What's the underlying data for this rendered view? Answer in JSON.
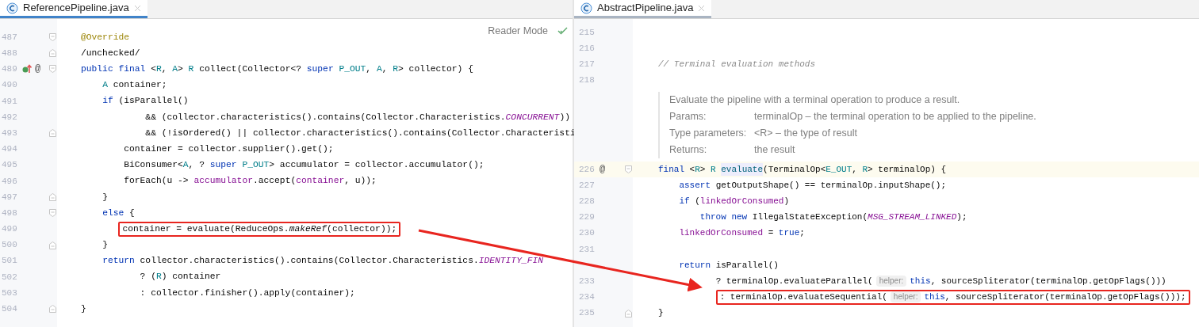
{
  "panes": [
    {
      "tab": {
        "title": "ReferencePipeline.java",
        "selected": true
      },
      "reader_mode": "Reader Mode",
      "lines": [
        {
          "kind": "code",
          "number": "487",
          "fold": {
            "kind": "start"
          },
          "current": false,
          "boxed": false,
          "tokens": [
            {
              "text": "@Override",
              "kind": "annotation"
            }
          ]
        },
        {
          "kind": "code",
          "number": "488",
          "fold": {
            "kind": "end"
          },
          "current": false,
          "boxed": false,
          "tokens": [
            {
              "text": "/unchecked/",
              "kind": "plain"
            }
          ]
        },
        {
          "kind": "code",
          "number": "489",
          "fold": {
            "kind": "start"
          },
          "current": false,
          "boxed": false,
          "override_mark": true,
          "at_mark": "@",
          "tokens": [
            {
              "text": "public final ",
              "kind": "keyword"
            },
            {
              "text": "<",
              "kind": "plain"
            },
            {
              "text": "R",
              "kind": "type_param"
            },
            {
              "text": ", ",
              "kind": "plain"
            },
            {
              "text": "A",
              "kind": "type_param"
            },
            {
              "text": "> ",
              "kind": "plain"
            },
            {
              "text": "R",
              "kind": "type_param"
            },
            {
              "text": " collect(Collector<? ",
              "kind": "plain"
            },
            {
              "text": "super ",
              "kind": "keyword"
            },
            {
              "text": "P_OUT",
              "kind": "type_param"
            },
            {
              "text": ", ",
              "kind": "plain"
            },
            {
              "text": "A",
              "kind": "type_param"
            },
            {
              "text": ", ",
              "kind": "plain"
            },
            {
              "text": "R",
              "kind": "type_param"
            },
            {
              "text": "> collector) {",
              "kind": "plain"
            }
          ]
        },
        {
          "kind": "code",
          "number": "490",
          "current": false,
          "boxed": false,
          "tokens": [
            {
              "text": "    A",
              "kind": "type_param"
            },
            {
              "text": " container;",
              "kind": "plain"
            }
          ]
        },
        {
          "kind": "code",
          "number": "491",
          "current": false,
          "boxed": false,
          "tokens": [
            {
              "text": "    if ",
              "kind": "keyword"
            },
            {
              "text": "(isParallel()",
              "kind": "plain"
            }
          ]
        },
        {
          "kind": "code",
          "number": "492",
          "current": false,
          "boxed": false,
          "tokens": [
            {
              "text": "            && (collector.characteristics().contains(Collector.Characteristics.",
              "kind": "plain"
            },
            {
              "text": "CONCURRENT",
              "kind": "constant"
            },
            {
              "text": "))",
              "kind": "plain"
            }
          ]
        },
        {
          "kind": "code",
          "number": "493",
          "fold": {
            "kind": "end"
          },
          "current": false,
          "boxed": false,
          "tokens": [
            {
              "text": "            && (!isOrdered() || collector.characteristics().contains(Collector.Characteristi",
              "kind": "plain"
            }
          ]
        },
        {
          "kind": "code",
          "number": "494",
          "current": false,
          "boxed": false,
          "tokens": [
            {
              "text": "        container = collector.supplier().get();",
              "kind": "plain"
            }
          ]
        },
        {
          "kind": "code",
          "number": "495",
          "current": false,
          "boxed": false,
          "tokens": [
            {
              "text": "        BiConsumer<",
              "kind": "plain"
            },
            {
              "text": "A",
              "kind": "type_param"
            },
            {
              "text": ", ? ",
              "kind": "plain"
            },
            {
              "text": "super ",
              "kind": "keyword"
            },
            {
              "text": "P_OUT",
              "kind": "type_param"
            },
            {
              "text": "> accumulator = collector.accumulator();",
              "kind": "plain"
            }
          ]
        },
        {
          "kind": "code",
          "number": "496",
          "current": false,
          "boxed": false,
          "tokens": [
            {
              "text": "        forEach(u -> ",
              "kind": "plain"
            },
            {
              "text": "accumulator",
              "kind": "field"
            },
            {
              "text": ".accept(",
              "kind": "plain"
            },
            {
              "text": "container",
              "kind": "field"
            },
            {
              "text": ", u));",
              "kind": "plain"
            }
          ]
        },
        {
          "kind": "code",
          "number": "497",
          "fold": {
            "kind": "end"
          },
          "current": false,
          "boxed": false,
          "tokens": [
            {
              "text": "    }",
              "kind": "plain"
            }
          ]
        },
        {
          "kind": "code",
          "number": "498",
          "fold": {
            "kind": "start"
          },
          "current": false,
          "boxed": false,
          "tokens": [
            {
              "text": "    else",
              "kind": "keyword"
            },
            {
              "text": " {",
              "kind": "plain"
            }
          ]
        },
        {
          "kind": "code",
          "number": "499",
          "current": false,
          "boxed": true,
          "tokens": [
            {
              "text": "       container = evaluate(ReduceOps.",
              "kind": "plain"
            },
            {
              "text": "makeRef",
              "kind": "static_call"
            },
            {
              "text": "(collector));",
              "kind": "plain"
            }
          ]
        },
        {
          "kind": "code",
          "number": "500",
          "fold": {
            "kind": "end"
          },
          "current": false,
          "boxed": false,
          "tokens": [
            {
              "text": "    }",
              "kind": "plain"
            }
          ]
        },
        {
          "kind": "code",
          "number": "501",
          "current": false,
          "boxed": false,
          "tokens": [
            {
              "text": "    return ",
              "kind": "keyword"
            },
            {
              "text": "collector.characteristics().contains(Collector.Characteristics.",
              "kind": "plain"
            },
            {
              "text": "IDENTITY_FIN",
              "kind": "constant"
            }
          ]
        },
        {
          "kind": "code",
          "number": "502",
          "current": false,
          "boxed": false,
          "tokens": [
            {
              "text": "           ? (",
              "kind": "plain"
            },
            {
              "text": "R",
              "kind": "type_param"
            },
            {
              "text": ") container",
              "kind": "plain"
            }
          ]
        },
        {
          "kind": "code",
          "number": "503",
          "current": false,
          "boxed": false,
          "tokens": [
            {
              "text": "           : collector.finisher().apply(container);",
              "kind": "plain"
            }
          ]
        },
        {
          "kind": "code",
          "number": "504",
          "fold": {
            "kind": "end"
          },
          "current": false,
          "boxed": false,
          "tokens": [
            {
              "text": "}",
              "kind": "plain"
            }
          ]
        }
      ]
    },
    {
      "tab": {
        "title": "AbstractPipeline.java",
        "selected": false
      },
      "lines": [
        {
          "kind": "code",
          "number": "215",
          "current": false,
          "boxed": false
        },
        {
          "kind": "code",
          "number": "216",
          "current": false,
          "boxed": false
        },
        {
          "kind": "code",
          "number": "217",
          "current": false,
          "boxed": false,
          "tokens": [
            {
              "text": "// Terminal evaluation methods",
              "kind": "comment"
            }
          ]
        },
        {
          "kind": "code",
          "number": "218",
          "current": false,
          "boxed": false
        },
        {
          "kind": "doc",
          "summary": "Evaluate the pipeline with a terminal operation to produce a result.",
          "rows": [
            {
              "label": "Params:",
              "value": "terminalOp – the terminal operation to be applied to the pipeline."
            },
            {
              "label": "Type parameters:",
              "value": "<R> – the type of result"
            },
            {
              "label": "Returns:",
              "value": "the result"
            }
          ]
        },
        {
          "kind": "code",
          "number": "226",
          "fold": {
            "kind": "start"
          },
          "current": true,
          "boxed": false,
          "at_mark": "@",
          "tokens": [
            {
              "text": "final ",
              "kind": "keyword"
            },
            {
              "text": "<",
              "kind": "plain"
            },
            {
              "text": "R",
              "kind": "type_param"
            },
            {
              "text": "> ",
              "kind": "plain"
            },
            {
              "text": "R ",
              "kind": "type_param"
            },
            {
              "text": "evaluate",
              "kind": "declaration"
            },
            {
              "text": "(TerminalOp<",
              "kind": "plain"
            },
            {
              "text": "E_OUT",
              "kind": "type_param"
            },
            {
              "text": ", ",
              "kind": "plain"
            },
            {
              "text": "R",
              "kind": "type_param"
            },
            {
              "text": "> terminalOp) {",
              "kind": "plain"
            }
          ]
        },
        {
          "kind": "code",
          "number": "227",
          "current": false,
          "boxed": false,
          "tokens": [
            {
              "text": "    assert ",
              "kind": "keyword"
            },
            {
              "text": "getOutputShape() == terminalOp.inputShape();",
              "kind": "plain"
            }
          ]
        },
        {
          "kind": "code",
          "number": "228",
          "current": false,
          "boxed": false,
          "tokens": [
            {
              "text": "    if ",
              "kind": "keyword"
            },
            {
              "text": "(",
              "kind": "plain"
            },
            {
              "text": "linkedOrConsumed",
              "kind": "field"
            },
            {
              "text": ")",
              "kind": "plain"
            }
          ]
        },
        {
          "kind": "code",
          "number": "229",
          "current": false,
          "boxed": false,
          "tokens": [
            {
              "text": "        throw new ",
              "kind": "keyword"
            },
            {
              "text": "IllegalStateException(",
              "kind": "plain"
            },
            {
              "text": "MSG_STREAM_LINKED",
              "kind": "constant"
            },
            {
              "text": ");",
              "kind": "plain"
            }
          ]
        },
        {
          "kind": "code",
          "number": "230",
          "current": false,
          "boxed": false,
          "tokens": [
            {
              "text": "    linkedOrConsumed",
              "kind": "field"
            },
            {
              "text": " = ",
              "kind": "plain"
            },
            {
              "text": "true",
              "kind": "keyword"
            },
            {
              "text": ";",
              "kind": "plain"
            }
          ]
        },
        {
          "kind": "code",
          "number": "231",
          "current": false,
          "boxed": false
        },
        {
          "kind": "code",
          "current": false,
          "boxed": false,
          "tokens": [
            {
              "text": "    return ",
              "kind": "keyword"
            },
            {
              "text": "isParallel()",
              "kind": "plain"
            }
          ]
        },
        {
          "kind": "code",
          "number": "233",
          "current": false,
          "boxed": false,
          "tokens": [
            {
              "text": "           ? terminalOp.evaluateParallel(",
              "kind": "plain"
            },
            {
              "text": "helper:",
              "kind": "hint"
            },
            {
              "text": "this",
              "kind": "keyword"
            },
            {
              "text": ", sourceSpliterator(terminalOp.getOpFlags()))",
              "kind": "plain"
            }
          ]
        },
        {
          "kind": "code",
          "number": "234",
          "current": false,
          "boxed": true,
          "tokens": [
            {
              "text": "           : terminalOp.evaluateSequential(",
              "kind": "plain"
            },
            {
              "text": "helper:",
              "kind": "hint"
            },
            {
              "text": "this",
              "kind": "keyword"
            },
            {
              "text": ", sourceSpliterator(terminalOp.getOpFlags()));",
              "kind": "plain"
            }
          ]
        },
        {
          "kind": "code",
          "number": "235",
          "fold": {
            "kind": "end"
          },
          "current": false,
          "boxed": false,
          "tokens": [
            {
              "text": "}",
              "kind": "plain"
            }
          ]
        }
      ]
    }
  ]
}
